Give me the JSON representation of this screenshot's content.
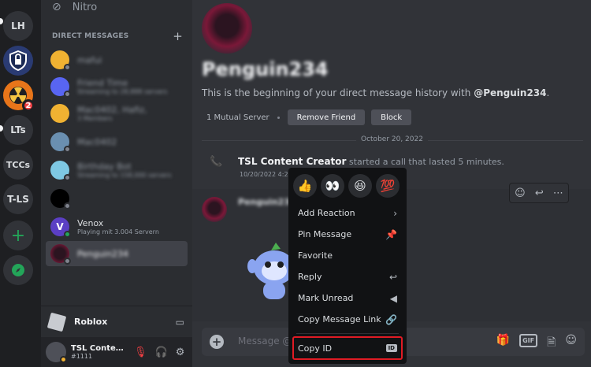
{
  "guilds": {
    "items": [
      {
        "label": "LH"
      },
      {
        "label": ""
      },
      {
        "label": "",
        "badge": "2"
      },
      {
        "label": "LTs"
      },
      {
        "label": "TCCs"
      },
      {
        "label": "T-LS"
      }
    ],
    "add_icon": "+",
    "explore_icon": "compass-icon"
  },
  "sidebar": {
    "nitro_label": "Nitro",
    "dm_header": "DIRECT MESSAGES",
    "dms": [
      {
        "name": "mafui",
        "sub": ""
      },
      {
        "name": "Friend Time",
        "sub": "Streaming to 28,888 servers"
      },
      {
        "name": "Mac0402, Hafiz,",
        "sub": "3 Members"
      },
      {
        "name": "Mac0402",
        "sub": ""
      },
      {
        "name": "Birthday Bot",
        "sub": "Streaming to 158,000 servers"
      },
      {
        "name": "",
        "sub": ""
      },
      {
        "name": "Venox",
        "sub": "Playing mit 3.004 Servern"
      },
      {
        "name": "Penguin234",
        "sub": ""
      }
    ],
    "activity": {
      "name": "Roblox"
    },
    "user": {
      "name": "TSL Content Creator",
      "tag": "#1111"
    }
  },
  "main": {
    "profile_name": "Penguin234",
    "beginning_text": "This is the beginning of your direct message history with ",
    "beginning_user": "@Penguin234",
    "beginning_end": ".",
    "mutual": "1 Mutual Server",
    "remove_friend": "Remove Friend",
    "block": "Block",
    "date_divider": "October 20, 2022",
    "call": {
      "author": "TSL Content Creator",
      "text": " started a call that lasted 5 minutes.",
      "time": "10/20/2022 4:2"
    },
    "message_author": "Penguin234",
    "composer_placeholder": "Message @"
  },
  "context_menu": {
    "emojis": [
      "👍",
      "👀",
      "😆",
      "💯"
    ],
    "items": [
      {
        "label": "Add Reaction",
        "icon": "chevron-right-icon",
        "glyph": "›"
      },
      {
        "label": "Pin Message",
        "icon": "pin-icon",
        "glyph": "📌"
      },
      {
        "label": "Favorite",
        "icon": "",
        "glyph": ""
      },
      {
        "label": "Reply",
        "icon": "reply-icon",
        "glyph": "↩"
      },
      {
        "label": "Mark Unread",
        "icon": "mark-unread-icon",
        "glyph": "◀"
      },
      {
        "label": "Copy Message Link",
        "icon": "link-icon",
        "glyph": "🔗"
      }
    ],
    "copy_id": {
      "label": "Copy ID",
      "icon": "id-icon",
      "glyph": "ID"
    }
  },
  "colors": {
    "highlight": "#e01b24",
    "online": "#23a559",
    "idle": "#f0b232"
  }
}
